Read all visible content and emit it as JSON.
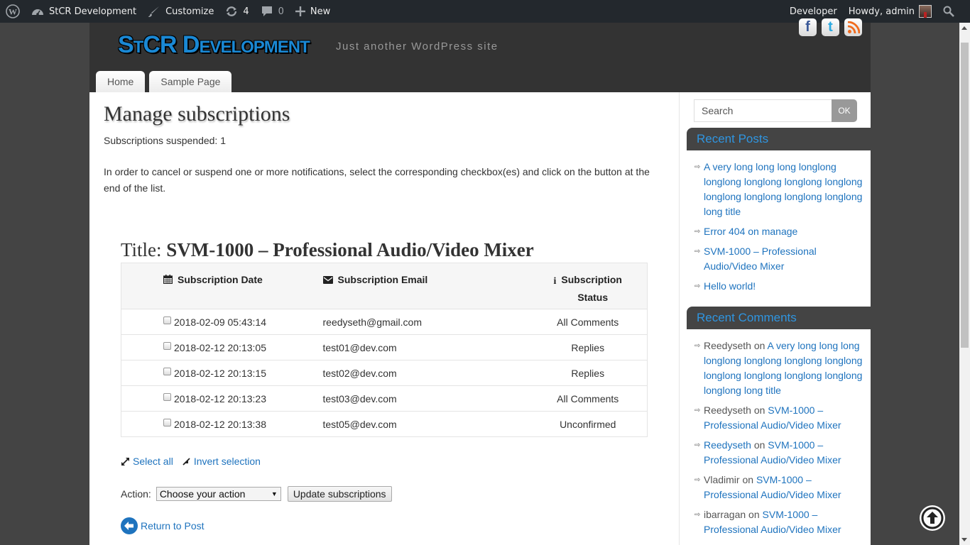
{
  "admin_bar": {
    "site_name": "StCR Development",
    "customize": "Customize",
    "updates_count": "4",
    "comments_count": "0",
    "new": "New",
    "developer": "Developer",
    "howdy": "Howdy, admin"
  },
  "header": {
    "site_title": "StCR Development",
    "tagline": "Just another WordPress site",
    "social": [
      "facebook",
      "twitter",
      "rss"
    ],
    "nav": [
      "Home",
      "Sample Page"
    ]
  },
  "main": {
    "page_title": "Manage subscriptions",
    "suspended_text": "Subscriptions suspended: 1",
    "instructions": "In order to cancel or suspend one or more notifications, select the corresponding checkbox(es) and click on the button at the end of the list.",
    "post_title_prefix": "Title:",
    "post_title": "SVM-1000 – Professional Audio/Video Mixer",
    "table": {
      "headers": {
        "date": "Subscription Date",
        "email": "Subscription Email",
        "status_line1": "Subscription",
        "status_line2": "Status"
      },
      "rows": [
        {
          "date": "2018-02-09 05:43:14",
          "email": "reedyseth@gmail.com",
          "status": "All Comments"
        },
        {
          "date": "2018-02-12 20:13:05",
          "email": "test01@dev.com",
          "status": "Replies"
        },
        {
          "date": "2018-02-12 20:13:15",
          "email": "test02@dev.com",
          "status": "Replies"
        },
        {
          "date": "2018-02-12 20:13:23",
          "email": "test03@dev.com",
          "status": "All Comments"
        },
        {
          "date": "2018-02-12 20:13:38",
          "email": "test05@dev.com",
          "status": "Unconfirmed"
        }
      ]
    },
    "select_all": "Select all",
    "invert_selection": "Invert selection",
    "action_label": "Action:",
    "action_selected": "Choose your action",
    "update_button": "Update subscriptions",
    "return_link": "Return to Post"
  },
  "sidebar": {
    "search_placeholder": "Search",
    "search_button": "OK",
    "recent_posts_title": "Recent Posts",
    "recent_posts": [
      "A very long long long longlong longlong longlong longlong longlong longlong longlong longlong longlong long title",
      "Error 404 on manage",
      "SVM-1000 – Professional Audio/Video Mixer",
      "Hello world!"
    ],
    "recent_comments_title": "Recent Comments",
    "recent_comments": [
      {
        "author": "Reedyseth",
        "author_link": true,
        "on": "on",
        "post": "A very long long long longlong longlong longlong longlong longlong longlong longlong longlong longlong long title"
      },
      {
        "author": "Reedyseth",
        "author_link": false,
        "on": "on",
        "post": "SVM-1000 – Professional Audio/Video Mixer"
      },
      {
        "author": "Reedyseth",
        "author_link": true,
        "on": "on",
        "post": "SVM-1000 – Professional Audio/Video Mixer"
      },
      {
        "author": "Vladimir",
        "author_link": false,
        "on": "on",
        "post": "SVM-1000 – Professional Audio/Video Mixer"
      },
      {
        "author": "ibarragan",
        "author_link": false,
        "on": "on",
        "post": "SVM-1000 – Professional Audio/Video Mixer"
      }
    ]
  },
  "colors": {
    "link": "#1e73be",
    "site_title": "#1a88d4",
    "admin_bar": "#23282d",
    "header_bg": "#333333",
    "page_bg": "#444444"
  }
}
